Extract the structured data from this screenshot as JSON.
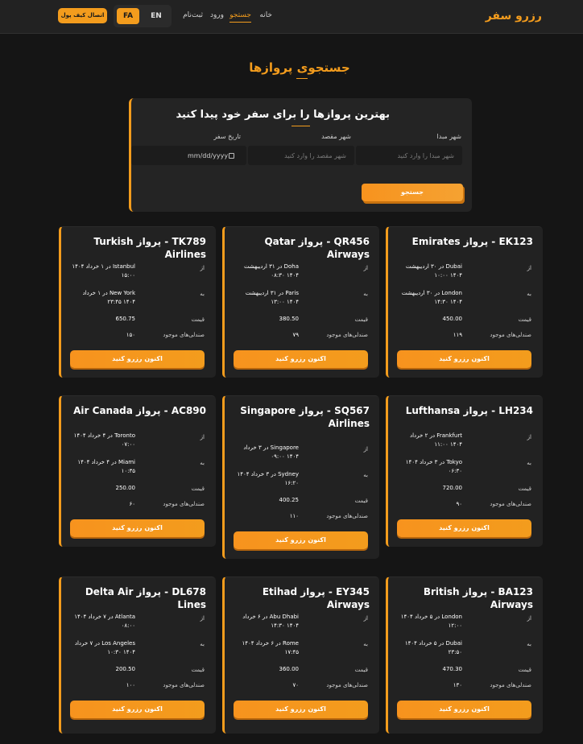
{
  "header": {
    "logo": "رزرو سفر",
    "nav": {
      "home": "خانه",
      "search": "جستجو",
      "login": "ورود",
      "register": "ثبت‌نام"
    },
    "lang": {
      "fa": "FA",
      "en": "EN"
    },
    "wallet": "اتصال کیف پول"
  },
  "page_title": "جستجوی پروازها",
  "search": {
    "heading": "بهترین پروازها را برای سفر خود پیدا کنید",
    "origin_label": "شهر مبدا",
    "origin_placeholder": "شهر مبدا را وارد کنید",
    "dest_label": "شهر مقصد",
    "dest_placeholder": "شهر مقصد را وارد کنید",
    "date_label": "تاریخ سفر",
    "date_value": "mm/dd/yyyy",
    "button": "جستجو"
  },
  "labels": {
    "from": "از",
    "to": "به",
    "price": "قیمت",
    "seats": "صندلی‌های موجود",
    "book": "اکنون رزرو کنید"
  },
  "flights": [
    {
      "title": "EK123 - پرواز Emirates",
      "from": "Dubai در ۳۰ اردیبهشت ۱۴۰۴ ۱۰:۰۰",
      "to": "London در ۳۰ اردیبهشت ۱۴۰۴ ۱۴:۳۰",
      "price": "450.00",
      "seats": "۱۱۹"
    },
    {
      "title": "QR456 - پرواز Qatar Airways",
      "from": "Doha در ۳۱ اردیبهشت ۱۴۰۴ ۰۸:۳۰",
      "to": "Paris در ۳۱ اردیبهشت ۱۴۰۴ ۱۳:۰۰",
      "price": "380.50",
      "seats": "۷۹"
    },
    {
      "title": "TK789 - پرواز Turkish Airlines",
      "from": "Istanbul در ۱ خرداد ۱۴۰۴ ۱۵:۰۰",
      "to": "New York در ۱ خرداد ۱۴۰۴ ۲۳:۴۵",
      "price": "650.75",
      "seats": "۱۵۰"
    },
    {
      "title": "LH234 - پرواز Lufthansa",
      "from": "Frankfurt در ۲ خرداد ۱۴۰۴ ۱۱:۰۰",
      "to": "Tokyo در ۳ خرداد ۱۴۰۴ ۰۶:۳۰",
      "price": "720.00",
      "seats": "۹۰"
    },
    {
      "title": "SQ567 - پرواز Singapore Airlines",
      "from": "Singapore در ۳ خرداد ۱۴۰۴ ۰۹:۰۰",
      "to": "Sydney در ۳ خرداد ۱۴۰۴ ۱۶:۲۰",
      "price": "400.25",
      "seats": "۱۱۰"
    },
    {
      "title": "AC890 - پرواز Air Canada",
      "from": "Toronto در ۴ خرداد ۱۴۰۴ ۰۷:۰۰",
      "to": "Miami در ۴ خرداد ۱۴۰۴ ۱۰:۳۵",
      "price": "250.00",
      "seats": "۶۰"
    },
    {
      "title": "BA123 - پرواز British Airways",
      "from": "London در ۵ خرداد ۱۴۰۴ ۱۲:۰۰",
      "to": "Dubai در ۵ خرداد ۱۴۰۴ ۲۳:۵۰",
      "price": "470.30",
      "seats": "۱۳۰"
    },
    {
      "title": "EY345 - پرواز Etihad Airways",
      "from": "Abu Dhabi در ۶ خرداد ۱۴۰۴ ۱۴:۳۰",
      "to": "Rome در ۶ خرداد ۱۴۰۴ ۱۷:۴۵",
      "price": "360.00",
      "seats": "۷۰"
    },
    {
      "title": "DL678 - پرواز Delta Air Lines",
      "from": "Atlanta در ۷ خرداد ۱۴۰۴ ۰۸:۰۰",
      "to": "Los Angeles در ۷ خرداد ۱۴۰۴ ۱۰:۳۰",
      "price": "200.50",
      "seats": "۱۰۰"
    }
  ],
  "colors": {
    "accent": "#f39c1d",
    "background": "#151515",
    "panel": "#222222"
  }
}
